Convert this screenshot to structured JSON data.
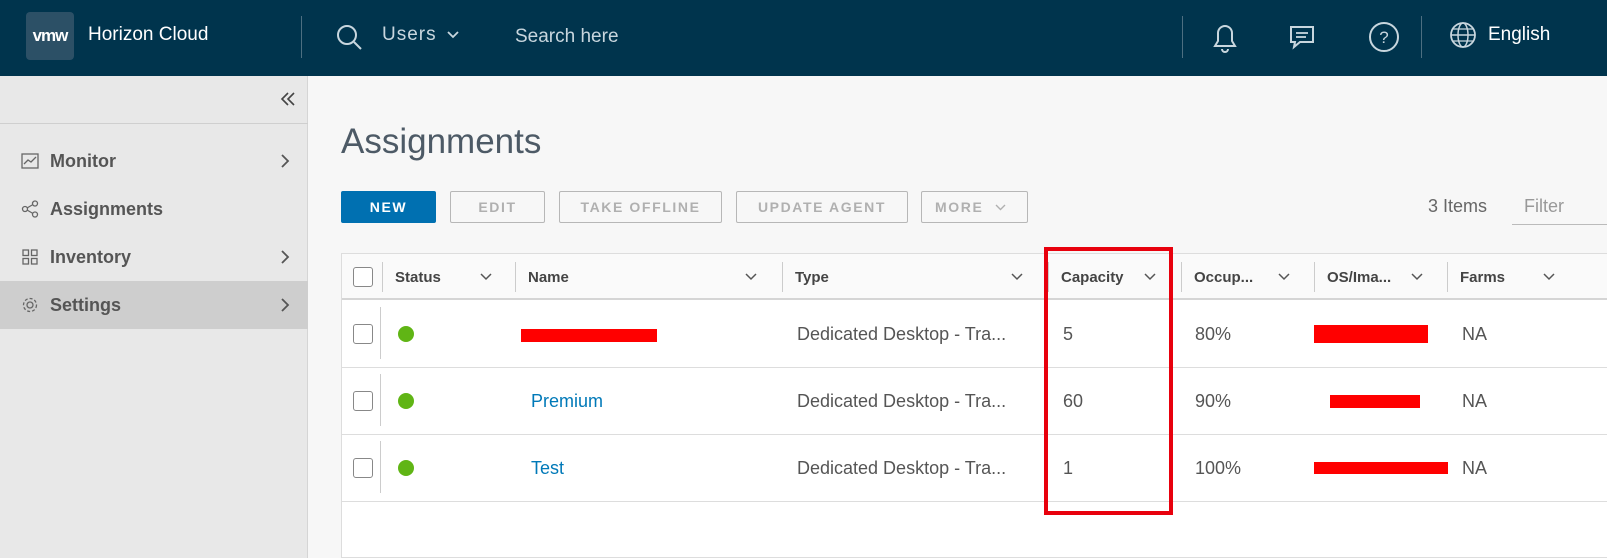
{
  "header": {
    "logo_text": "vmw",
    "app_title": "Horizon Cloud",
    "search_scope": "Users",
    "search_placeholder": "Search here",
    "language": "English",
    "bg_color": "#00344d"
  },
  "sidebar": {
    "items": [
      {
        "label": "Monitor",
        "icon": "chart-icon",
        "has_chevron": true
      },
      {
        "label": "Assignments",
        "icon": "share-icon",
        "has_chevron": false
      },
      {
        "label": "Inventory",
        "icon": "grid-icon",
        "has_chevron": true
      },
      {
        "label": "Settings",
        "icon": "gear-icon",
        "has_chevron": true,
        "active": true
      }
    ]
  },
  "main": {
    "title": "Assignments",
    "buttons": {
      "new": "NEW",
      "edit": "EDIT",
      "take_offline": "TAKE OFFLINE",
      "update_agent": "UPDATE AGENT",
      "more": "MORE"
    },
    "items_count": "3 Items",
    "filter_placeholder": "Filter"
  },
  "grid": {
    "columns": [
      "Status",
      "Name",
      "Type",
      "Capacity",
      "Occup...",
      "OS/Ima...",
      "Farms"
    ],
    "rows": [
      {
        "status_color": "#60b515",
        "name": "",
        "type": "Dedicated Desktop - Tra...",
        "capacity": "5",
        "occupancy": "80%",
        "os_image": "",
        "farms": "NA"
      },
      {
        "status_color": "#60b515",
        "name": "Premium",
        "type": "Dedicated Desktop - Tra...",
        "capacity": "60",
        "occupancy": "90%",
        "os_image": "",
        "farms": "NA"
      },
      {
        "status_color": "#60b515",
        "name": "Test",
        "type": "Dedicated Desktop - Tra...",
        "capacity": "1",
        "occupancy": "100%",
        "os_image": "",
        "farms": "NA"
      }
    ]
  },
  "colors": {
    "primary": "#0070b1",
    "link": "#0079b8",
    "status_ok": "#60b515",
    "highlight": "#e8000d"
  }
}
